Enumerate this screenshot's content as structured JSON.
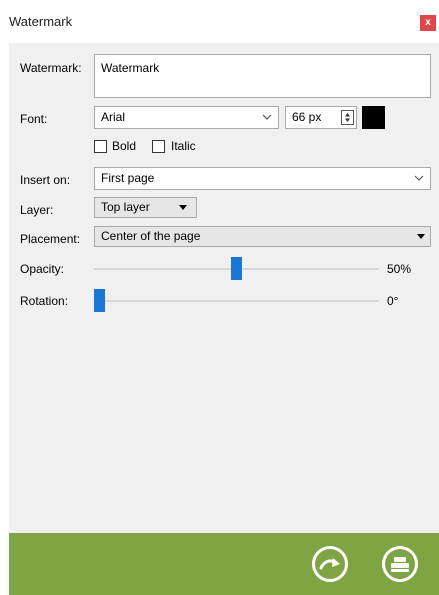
{
  "window": {
    "title": "Watermark",
    "close_label": "x"
  },
  "watermark": {
    "label": "Watermark:",
    "value": "Watermark"
  },
  "font": {
    "label": "Font:",
    "family": "Arial",
    "size": "66 px",
    "color": "#000000"
  },
  "style": {
    "bold": "Bold",
    "italic": "Italic"
  },
  "insert_on": {
    "label": "Insert on:",
    "value": "First page"
  },
  "layer": {
    "label": "Layer:",
    "value": "Top layer"
  },
  "placement": {
    "label": "Placement:",
    "value": "Center of the page"
  },
  "opacity": {
    "label": "Opacity:",
    "value_text": "50%",
    "level": 0.5
  },
  "rotation": {
    "label": "Rotation:",
    "value_text": "0°",
    "level": 0
  },
  "footer": {
    "apply_icon": "redo-arrow-icon",
    "save_icon": "stamp-icon",
    "accent": "#7fa444"
  }
}
